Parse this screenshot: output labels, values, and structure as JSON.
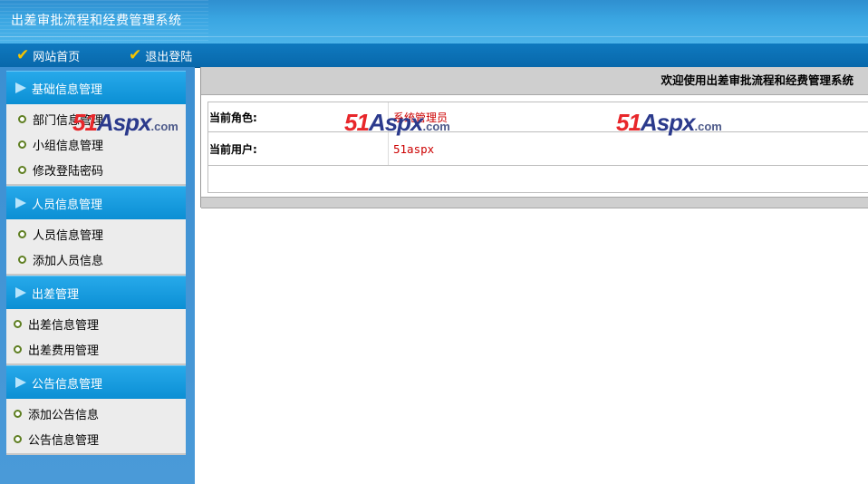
{
  "header": {
    "title": "出差审批流程和经费管理系统"
  },
  "nav": {
    "home_label": "网站首页",
    "logout_label": "退出登陆",
    "check_glyph": "✔"
  },
  "sidebar": {
    "groups": [
      {
        "title": "基础信息管理",
        "items": [
          "部门信息管理",
          "小组信息管理",
          "修改登陆密码"
        ]
      },
      {
        "title": "人员信息管理",
        "items": [
          "人员信息管理",
          "添加人员信息"
        ]
      },
      {
        "title": "出差管理",
        "items": [
          "出差信息管理",
          "出差费用管理"
        ]
      },
      {
        "title": "公告信息管理",
        "items": [
          "添加公告信息",
          "公告信息管理"
        ]
      }
    ]
  },
  "main": {
    "welcome": "欢迎使用出差审批流程和经费管理系统",
    "role_label": "当前角色:",
    "role_value": "系统管理员",
    "user_label": "当前用户:",
    "user_value": "51aspx"
  },
  "watermark": {
    "num": "51",
    "text": "Aspx",
    "domain": ".com"
  },
  "colors": {
    "header_blue": "#3aa6e2",
    "nav_blue": "#0b6fb3",
    "menu_head": "#0b8fd4",
    "value_red": "#cc0000",
    "check_yellow": "#f5c400"
  }
}
